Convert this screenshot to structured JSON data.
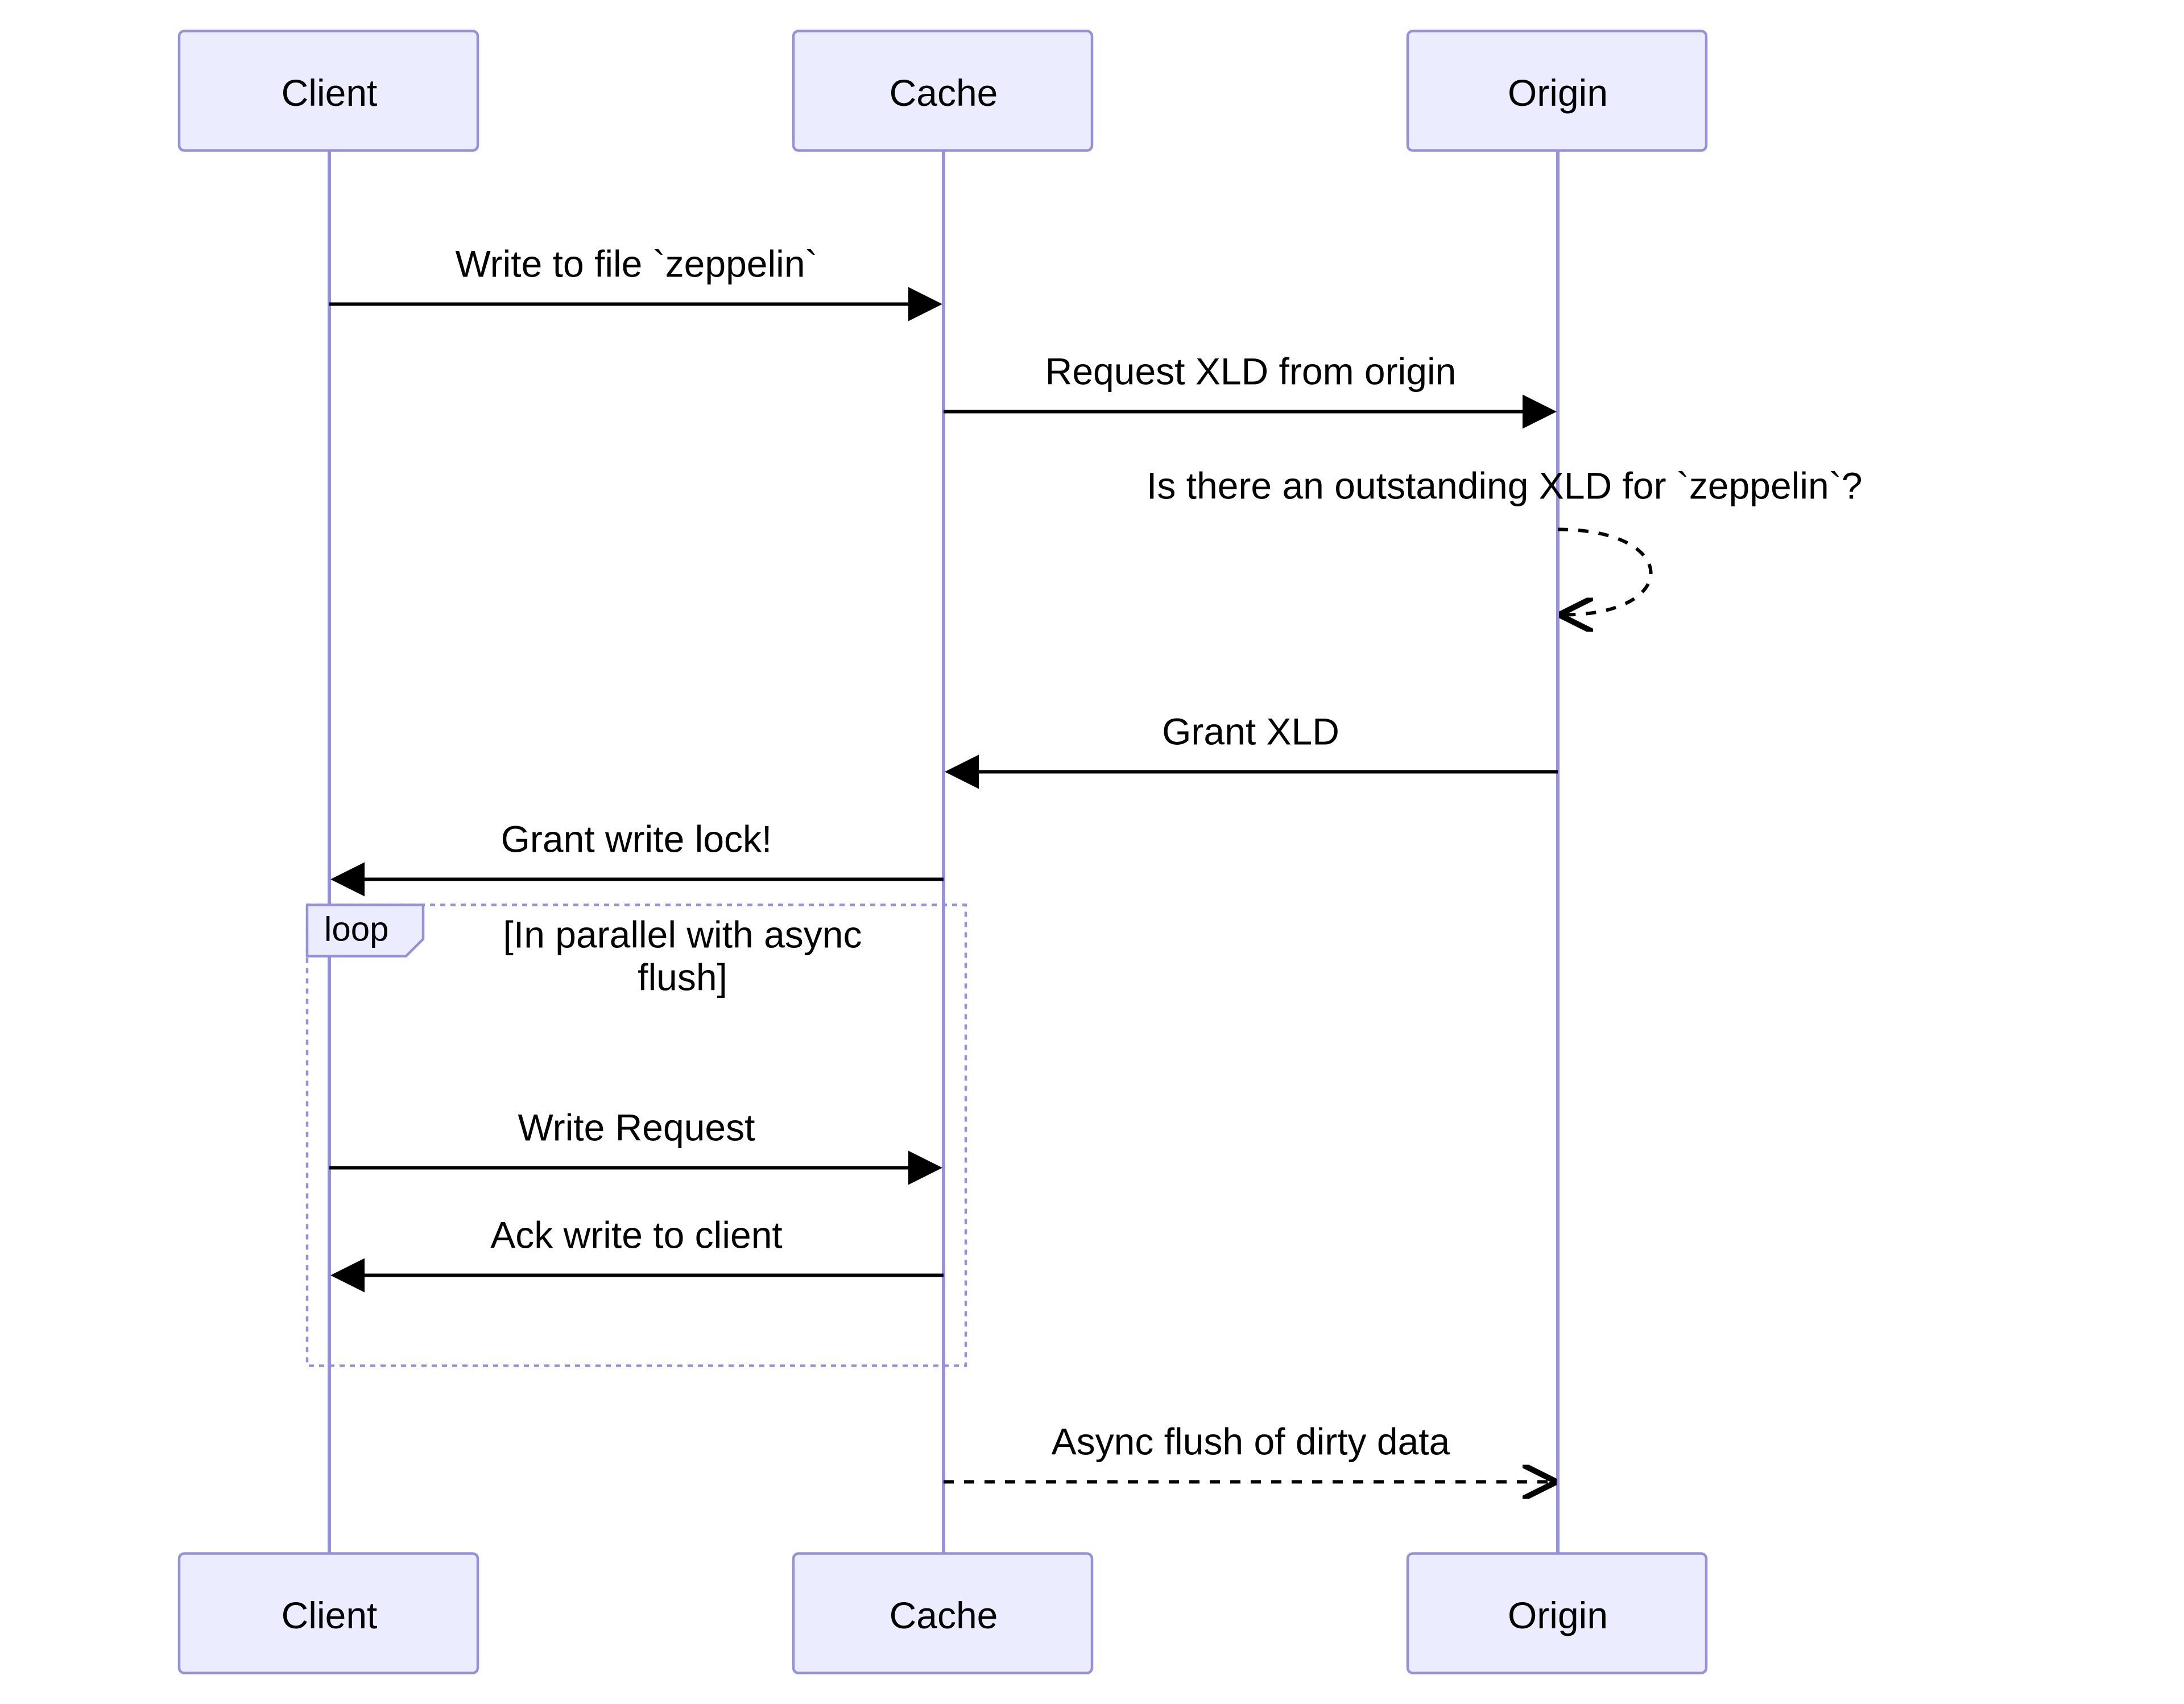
{
  "diagram": {
    "actors": {
      "client": "Client",
      "cache": "Cache",
      "origin": "Origin"
    },
    "messages": {
      "m1": "Write to file `zeppelin`",
      "m2": "Request XLD from origin",
      "m3": "Is there an outstanding XLD for `zeppelin`?",
      "m4": "Grant XLD",
      "m5": "Grant write lock!",
      "m6": "Write Request",
      "m7": "Ack write to client",
      "m8": "Async flush of dirty data"
    },
    "loop": {
      "tag": "loop",
      "condition1": "[In parallel with async",
      "condition2": "flush]"
    }
  }
}
